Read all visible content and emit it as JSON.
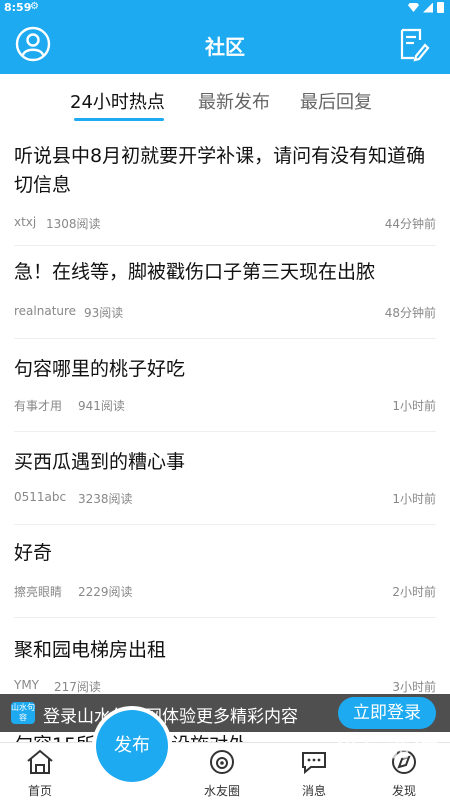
{
  "status_bar": {
    "time": "8:59"
  },
  "header": {
    "title": "社区"
  },
  "tabs": [
    {
      "label": "24小时热点",
      "active": true
    },
    {
      "label": "最新发布",
      "active": false
    },
    {
      "label": "最后回复",
      "active": false
    }
  ],
  "posts": [
    {
      "title": "听说县中8月初就要开学补课，请问有没有知道确切信息",
      "author": "xtxj",
      "reads": "1308阅读",
      "time": "44分钟前"
    },
    {
      "title": "急！在线等，脚被戳伤口子第三天现在出脓",
      "author": "realnature",
      "reads": "93阅读",
      "time": "48分钟前"
    },
    {
      "title": "句容哪里的桃子好吃",
      "author": "有事才用",
      "reads": "941阅读",
      "time": "1小时前"
    },
    {
      "title": "买西瓜遇到的糟心事",
      "author": "0511abc",
      "reads": "3238阅读",
      "time": "1小时前"
    },
    {
      "title": "好奇",
      "author": "擦亮眼睛",
      "reads": "2229阅读",
      "time": "2小时前"
    },
    {
      "title": "聚和园电梯房出租",
      "author": "YMY",
      "reads": "217阅读",
      "time": "3小时前"
    }
  ],
  "peek_post_title": "句容15所学校教育设施对外",
  "banner": {
    "logo_text": "山水句容",
    "text": "登录山水句容网体验更多精彩内容",
    "button": "立即登录"
  },
  "tabbar": {
    "home": "首页",
    "publish": "发布",
    "circle": "水友圈",
    "messages": "消息",
    "discover": "发现"
  },
  "watermark": {
    "title": "仍玩游戏",
    "sub": "rengwan"
  },
  "colors": {
    "brand": "#1eaaf1"
  }
}
